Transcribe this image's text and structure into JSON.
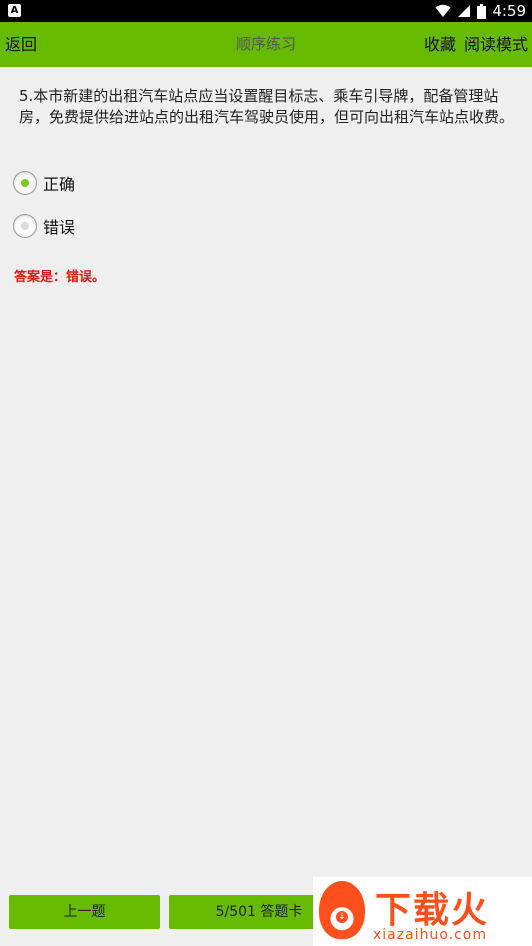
{
  "status_bar": {
    "notification_glyph": "A",
    "time": "4:59",
    "icons": [
      "wifi-icon",
      "signal-icon",
      "battery-icon"
    ]
  },
  "app_bar": {
    "back_label": "返回",
    "title": "顺序练习",
    "favorite_label": "收藏",
    "read_mode_label": "阅读模式",
    "background": "#66bb00"
  },
  "question": {
    "text": "5.本市新建的出租汽车站点应当设置醒目标志、乘车引导牌，配备管理站房，免费提供给进站点的出租汽车驾驶员使用，但可向出租汽车站点收费。"
  },
  "options": [
    {
      "label": "正确",
      "selected": true
    },
    {
      "label": "错误",
      "selected": false
    }
  ],
  "answer": {
    "text": "答案是：错误。",
    "color": "#e01818"
  },
  "footer": {
    "prev_label": "上一题",
    "card_label": "5/501 答题卡"
  },
  "watermark": {
    "brand": "下载火",
    "domain": "xiazaihuo.com"
  }
}
